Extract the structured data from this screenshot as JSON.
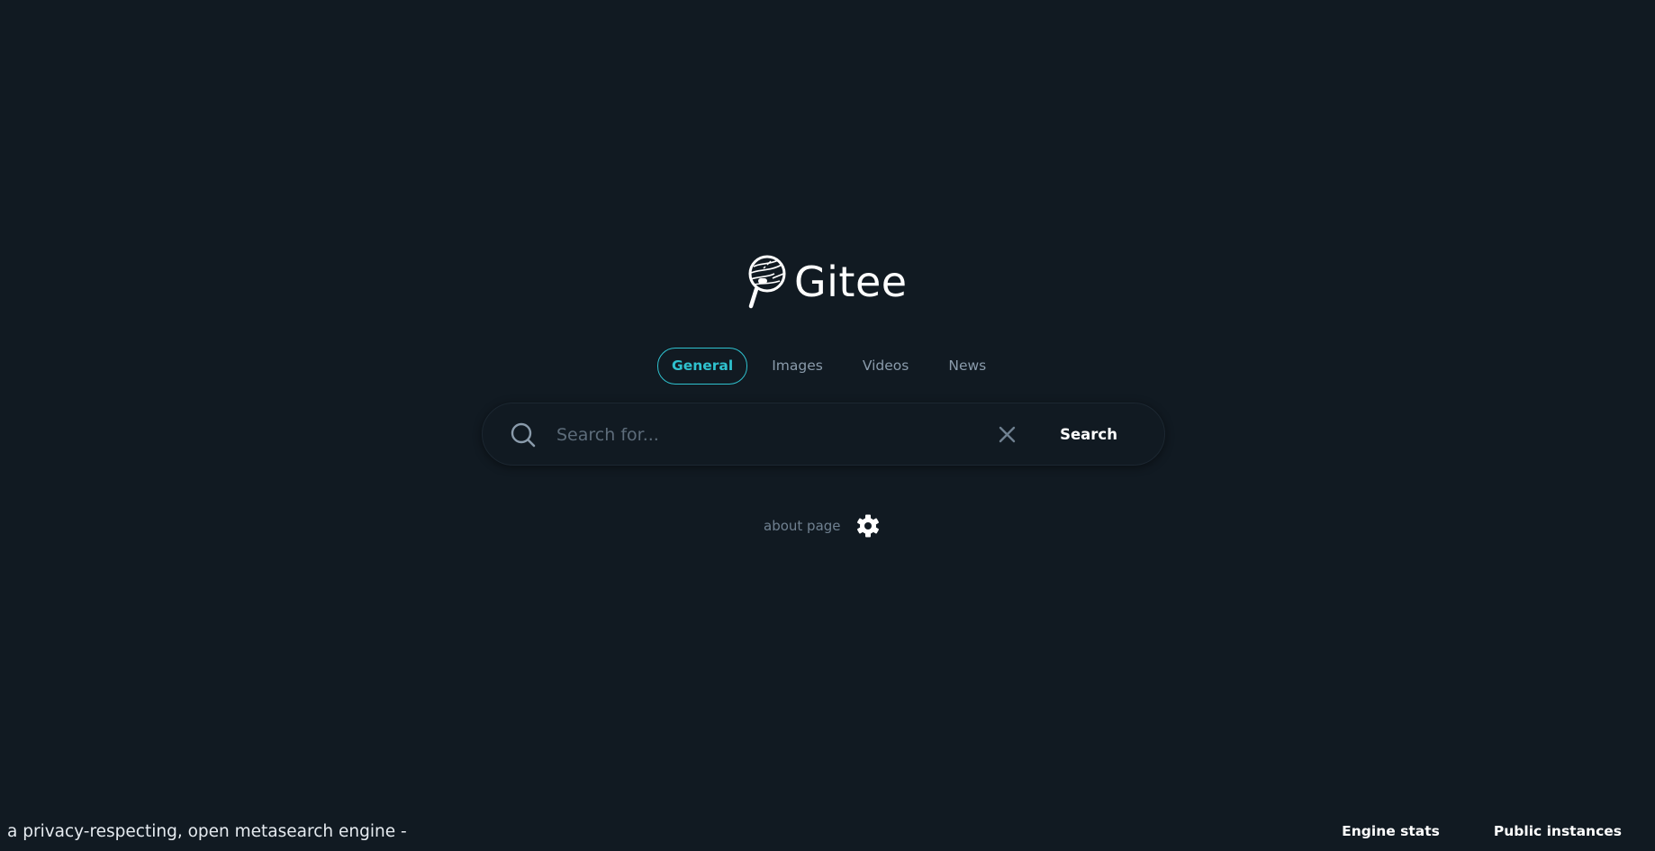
{
  "brand": {
    "name": "Gitee",
    "logo_icon": "magnifier-globe-icon"
  },
  "tabs": [
    {
      "label": "General",
      "active": true
    },
    {
      "label": "Images",
      "active": false
    },
    {
      "label": "Videos",
      "active": false
    },
    {
      "label": "News",
      "active": false
    }
  ],
  "search": {
    "placeholder": "Search for...",
    "value": "",
    "button_label": "Search",
    "icons": {
      "search": "search-icon",
      "clear": "close-icon"
    }
  },
  "about": {
    "link_label": "about page",
    "settings_icon": "gear-icon"
  },
  "footer": {
    "tagline": "a privacy-respecting, open metasearch engine -",
    "links": [
      "Engine stats",
      "Public instances"
    ]
  },
  "colors": {
    "background": "#111a22",
    "accent": "#2fc2cf",
    "muted_text": "#8a9bab"
  }
}
